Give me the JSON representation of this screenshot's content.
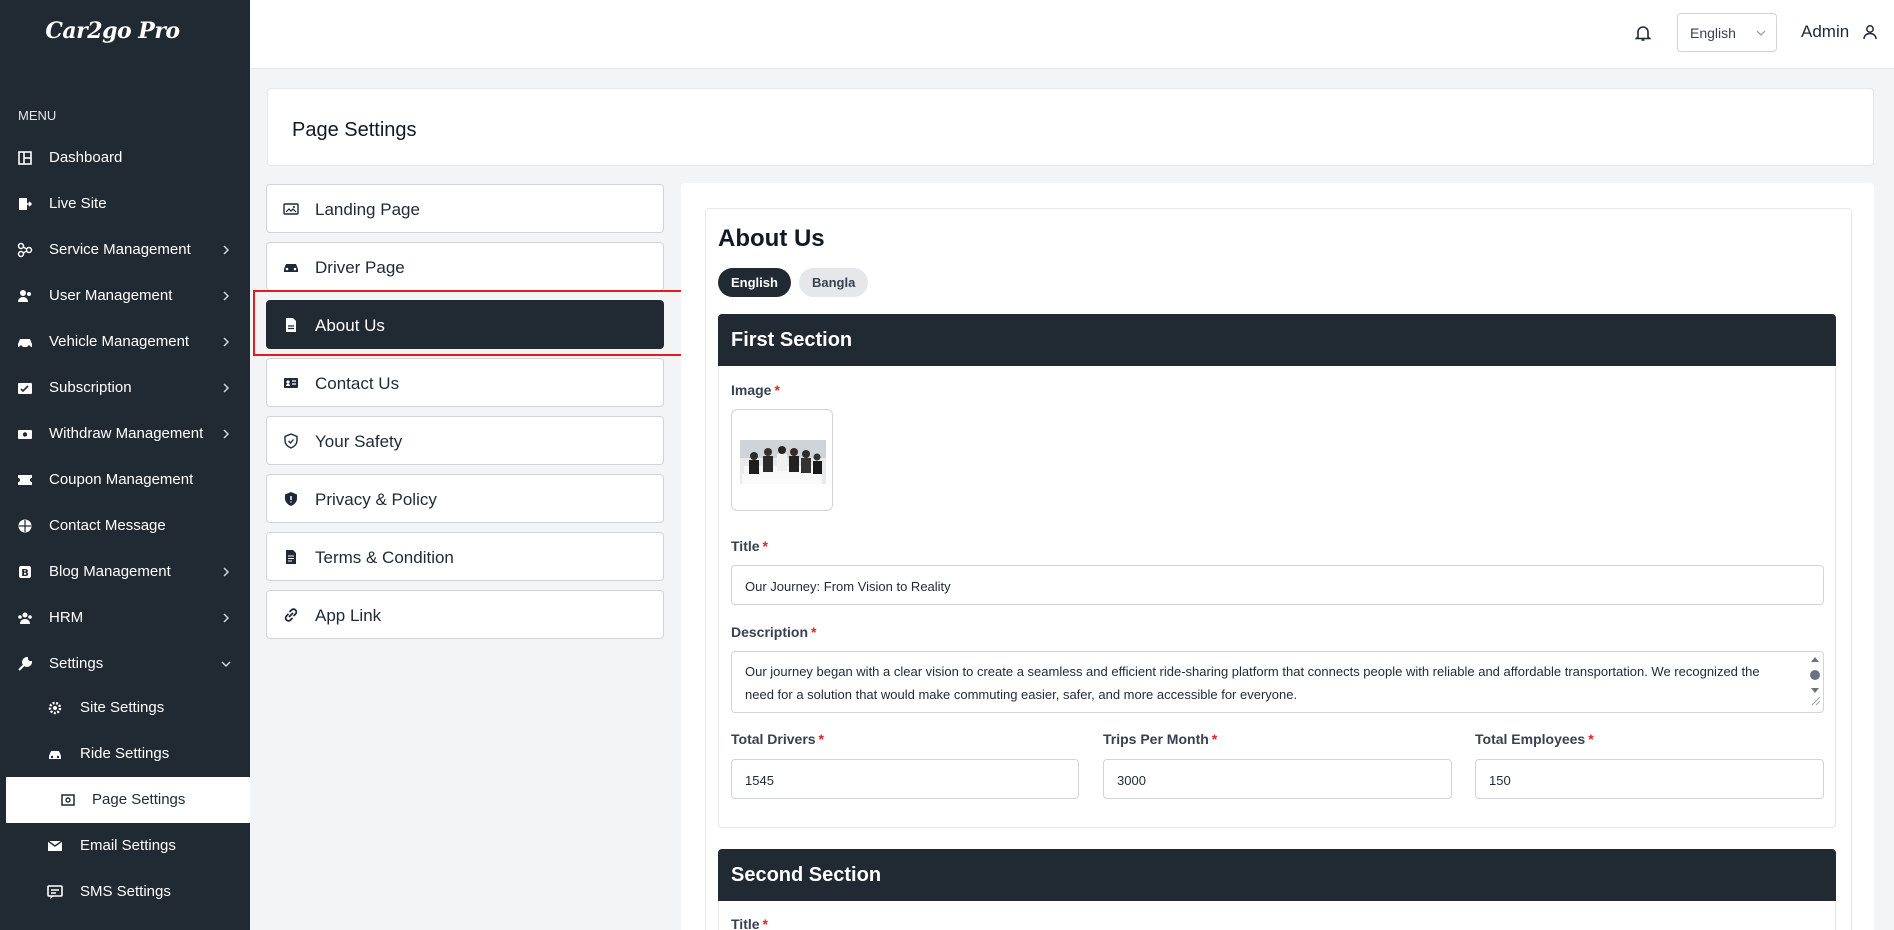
{
  "app": {
    "logo": "Car2go Pro"
  },
  "sidebar": {
    "menu_label": "MENU",
    "items": [
      {
        "label": "Dashboard",
        "icon": "dashboard-icon"
      },
      {
        "label": "Live Site",
        "icon": "live-site-icon"
      },
      {
        "label": "Service Management",
        "icon": "service-icon"
      },
      {
        "label": "User Management",
        "icon": "users-icon"
      },
      {
        "label": "Vehicle Management",
        "icon": "car-icon"
      },
      {
        "label": "Subscription",
        "icon": "subscription-icon"
      },
      {
        "label": "Withdraw Management",
        "icon": "money-icon"
      },
      {
        "label": "Coupon Management",
        "icon": "ticket-icon"
      },
      {
        "label": "Contact Message",
        "icon": "globe-icon"
      },
      {
        "label": "Blog Management",
        "icon": "blog-icon"
      },
      {
        "label": "HRM",
        "icon": "team-icon"
      },
      {
        "label": "Settings",
        "icon": "wrench-icon"
      }
    ],
    "sub_items": [
      {
        "label": "Site Settings",
        "icon": "gear-icon"
      },
      {
        "label": "Ride Settings",
        "icon": "car-icon"
      },
      {
        "label": "Page Settings",
        "icon": "page-icon"
      },
      {
        "label": "Email Settings",
        "icon": "email-icon"
      },
      {
        "label": "SMS Settings",
        "icon": "sms-icon"
      }
    ]
  },
  "topbar": {
    "language": "English",
    "user": "Admin"
  },
  "page": {
    "title": "Page Settings"
  },
  "page_tabs": [
    {
      "label": "Landing Page",
      "icon": "image-card-icon"
    },
    {
      "label": "Driver Page",
      "icon": "car-icon"
    },
    {
      "label": "About Us",
      "icon": "document-icon"
    },
    {
      "label": "Contact Us",
      "icon": "contact-card-icon"
    },
    {
      "label": "Your Safety",
      "icon": "shield-icon"
    },
    {
      "label": "Privacy & Policy",
      "icon": "shield-solid-icon"
    },
    {
      "label": "Terms & Condition",
      "icon": "file-text-icon"
    },
    {
      "label": "App Link",
      "icon": "link-icon"
    }
  ],
  "about": {
    "heading": "About Us",
    "langs": [
      "English",
      "Bangla"
    ],
    "first_section": {
      "title": "First Section",
      "image_label": "Image",
      "title_label": "Title",
      "title_value": "Our Journey: From Vision to Reality",
      "description_label": "Description",
      "description_value": "Our journey began with a clear vision to create a seamless and efficient ride-sharing platform that connects people with reliable and affordable transportation. We recognized the need for a solution that would make commuting easier, safer, and more accessible for everyone.",
      "drivers_label": "Total Drivers",
      "drivers_value": "1545",
      "trips_label": "Trips Per Month",
      "trips_value": "3000",
      "employees_label": "Total Employees",
      "employees_value": "150"
    },
    "second_section": {
      "title": "Second Section",
      "title_label": "Title"
    }
  },
  "colors": {
    "sidebar_bg": "#212933",
    "accent_dark": "#212933",
    "required": "#dc2626",
    "highlight": "#e11d24"
  }
}
